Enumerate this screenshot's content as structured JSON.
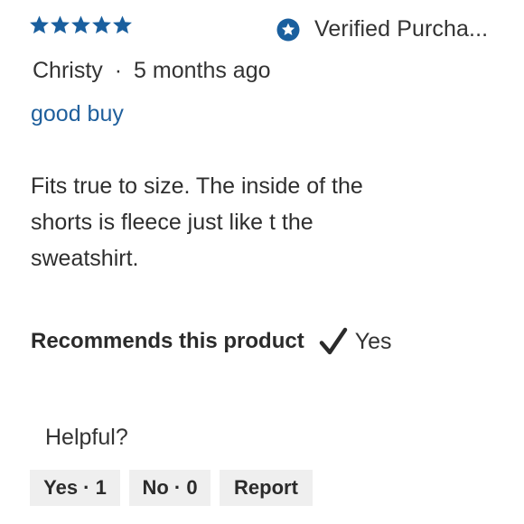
{
  "rating": {
    "stars": 5,
    "max": 5,
    "color": "#1a5f9e"
  },
  "verified": {
    "label": "Verified Purcha...",
    "icon": "star-badge-icon",
    "color": "#1a5f9e"
  },
  "author": {
    "name": "Christy",
    "separator": "·",
    "time": "5 months ago"
  },
  "review": {
    "title": "good buy",
    "title_color": "#1f5f9c",
    "body": "Fits true to size. The inside of the shorts is fleece just like t the sweatshirt."
  },
  "recommendation": {
    "label": "Recommends this product",
    "icon": "checkmark-icon",
    "value": "Yes"
  },
  "helpful": {
    "label": "Helpful?",
    "yes_label": "Yes · 1",
    "no_label": "No · 0",
    "report_label": "Report"
  }
}
